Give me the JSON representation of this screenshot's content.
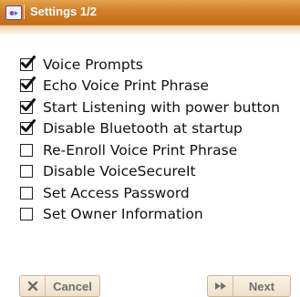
{
  "titlebar": {
    "title": "Settings 1/2",
    "app_icon": "voice-app-icon",
    "accent_color": "#d07f28"
  },
  "options": [
    {
      "label": "Voice Prompts",
      "checked": true
    },
    {
      "label": "Echo Voice Print Phrase",
      "checked": true
    },
    {
      "label": "Start Listening with power button",
      "checked": true
    },
    {
      "label": "Disable Bluetooth at startup",
      "checked": true
    },
    {
      "label": "Re-Enroll Voice Print Phrase",
      "checked": false
    },
    {
      "label": "Disable VoiceSecureIt",
      "checked": false
    },
    {
      "label": "Set Access Password",
      "checked": false
    },
    {
      "label": "Set Owner Information",
      "checked": false
    }
  ],
  "buttons": {
    "cancel_label": "Cancel",
    "cancel_icon": "close-icon",
    "next_label": "Next",
    "next_icon": "fast-forward-icon"
  }
}
